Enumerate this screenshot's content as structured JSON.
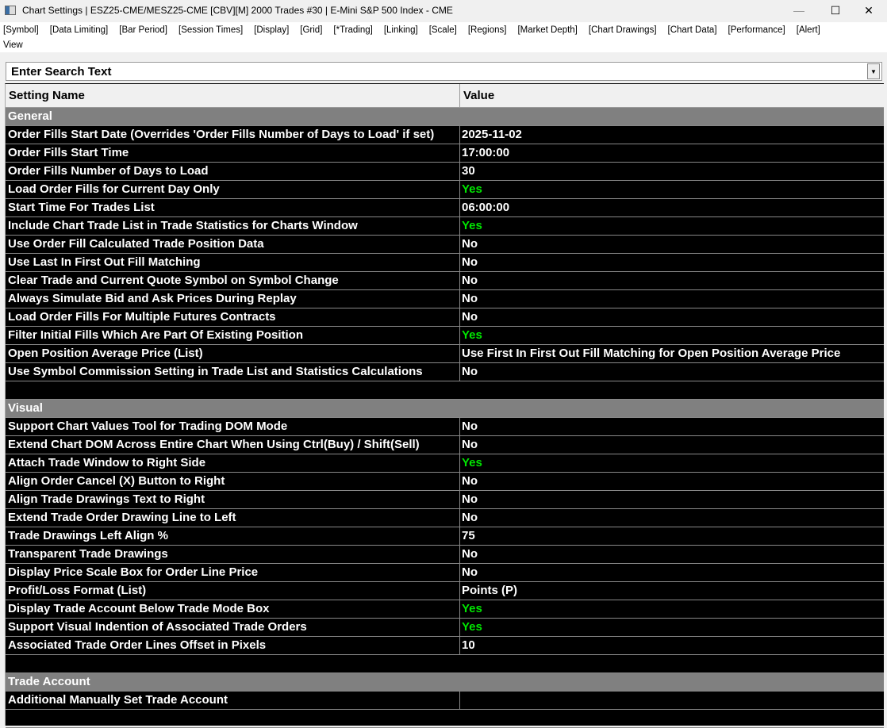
{
  "window": {
    "title": "Chart Settings | ESZ25-CME/MESZ25-CME [CBV][M]  2000 Trades #30 | E-Mini S&P 500 Index - CME",
    "minimize": "—",
    "maximize": "☐",
    "close": "✕"
  },
  "menu": [
    "[Symbol]",
    "[Data Limiting]",
    "[Bar Period]",
    "[Session Times]",
    "[Display]",
    "[Grid]",
    "[*Trading]",
    "[Linking]",
    "[Scale]",
    "[Regions]",
    "[Market Depth]",
    "[Chart Drawings]",
    "[Chart Data]",
    "[Performance]",
    "[Alert]"
  ],
  "menu2": "View",
  "search": {
    "placeholder": "Enter Search Text"
  },
  "columns": {
    "name": "Setting Name",
    "value": "Value"
  },
  "sections": [
    {
      "title": "General",
      "rows": [
        [
          "Order Fills Start Date (Overrides 'Order Fills Number of Days to Load' if set)",
          "2025-11-02"
        ],
        [
          "Order Fills Start Time",
          "17:00:00"
        ],
        [
          "Order Fills Number of Days to Load",
          "30"
        ],
        [
          "Load Order Fills for Current Day Only",
          "Yes"
        ],
        [
          "Start Time For Trades List",
          "06:00:00"
        ],
        [
          "Include Chart Trade List in Trade Statistics for Charts Window",
          "Yes"
        ],
        [
          "Use Order Fill Calculated Trade Position Data",
          "No"
        ],
        [
          "Use Last In First Out Fill Matching",
          "No"
        ],
        [
          "Clear Trade and Current Quote Symbol on Symbol Change",
          "No"
        ],
        [
          "Always Simulate Bid and Ask Prices During Replay",
          "No"
        ],
        [
          "Load Order Fills For Multiple Futures Contracts",
          "No"
        ],
        [
          "Filter Initial Fills Which Are Part Of Existing Position",
          "Yes"
        ],
        [
          "Open Position Average Price (List)",
          "Use First In First Out Fill Matching for Open Position Average Price"
        ],
        [
          "Use Symbol Commission Setting in Trade List and Statistics Calculations",
          "No"
        ]
      ]
    },
    {
      "title": "Visual",
      "rows": [
        [
          "Support Chart Values Tool for Trading DOM Mode",
          "No"
        ],
        [
          "Extend Chart DOM Across Entire Chart When Using Ctrl(Buy) / Shift(Sell)",
          "No"
        ],
        [
          "Attach Trade Window to Right Side",
          "Yes"
        ],
        [
          "Align Order Cancel (X) Button to Right",
          "No"
        ],
        [
          "Align Trade Drawings Text to Right",
          "No"
        ],
        [
          "Extend Trade Order Drawing Line to Left",
          "No"
        ],
        [
          "Trade Drawings Left Align %",
          "75"
        ],
        [
          "Transparent Trade Drawings",
          "No"
        ],
        [
          "Display Price Scale Box for Order Line Price",
          "No"
        ],
        [
          "Profit/Loss Format (List)",
          "Points (P)"
        ],
        [
          "Display Trade Account Below Trade Mode Box",
          "Yes"
        ],
        [
          "Support Visual Indention of Associated Trade Orders",
          "Yes"
        ],
        [
          "Associated Trade Order Lines Offset in Pixels",
          "10"
        ]
      ]
    },
    {
      "title": "Trade Account",
      "rows": [
        [
          "Additional Manually Set Trade Account",
          ""
        ]
      ]
    }
  ]
}
